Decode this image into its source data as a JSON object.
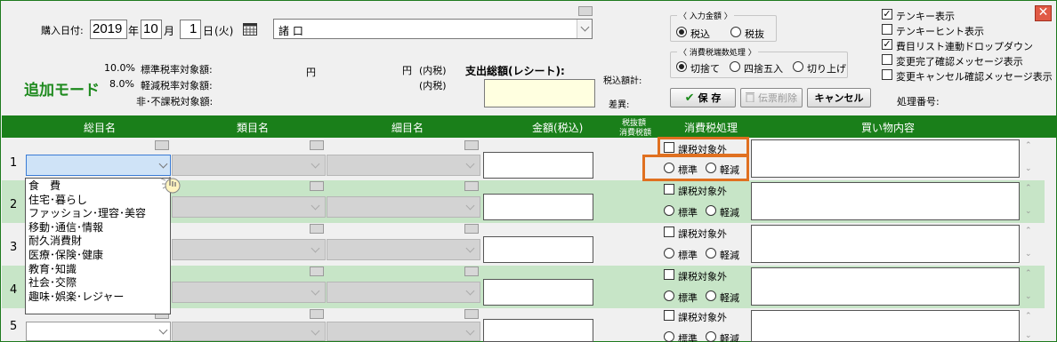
{
  "purchase_date": {
    "label": "購入日付:",
    "year": "2019",
    "year_unit": "年",
    "month": "10",
    "month_unit": "月",
    "day": "1",
    "day_unit": "日",
    "weekday": "(火)"
  },
  "store": {
    "value": "諸 口"
  },
  "mode": {
    "title": "追加モード"
  },
  "tax_summary": {
    "rate10": "10.0%",
    "rate10_label": "標準税率対象額:",
    "rate8": "8.0%",
    "rate8_label": "軽減税率対象額:",
    "nontax_label": "非･不課税対象額:",
    "yen": "円",
    "yen_incl": "円",
    "incl_tax1": "(内税)",
    "incl_tax2": "(内税)"
  },
  "total": {
    "label": "支出総額(レシート):",
    "incl_label": "税込額計:",
    "diff_label": "差異:"
  },
  "input_amount": {
    "title": "〈 入力金額 〉",
    "options": [
      "税込",
      "税抜"
    ],
    "selected": 0
  },
  "rounding": {
    "title": "〈 消費税端数処理 〉",
    "options": [
      "切捨て",
      "四捨五入",
      "切り上げ"
    ],
    "selected": 0
  },
  "buttons": {
    "save": "保 存",
    "delete": "伝票削除",
    "cancel": "キャンセル"
  },
  "process_no_label": "処理番号:",
  "options_list": [
    {
      "label": "テンキー表示",
      "checked": true
    },
    {
      "label": "テンキーヒント表示",
      "checked": false
    },
    {
      "label": "費目リスト連動ドロップダウン",
      "checked": true
    },
    {
      "label": "変更完了確認メッセージ表示",
      "checked": false
    },
    {
      "label": "変更キャンセル確認メッセージ表示",
      "checked": false
    }
  ],
  "columns": {
    "cat1": "総目名",
    "cat2": "類目名",
    "cat3": "細目名",
    "amount": "金額(税込)",
    "tax_excl1": "税抜額",
    "tax_excl2": "消費税額",
    "tax_proc": "消費税処理",
    "memo": "買い物内容"
  },
  "rows": [
    {
      "num": "1",
      "exempt": "課税対象外",
      "std": "標準",
      "reduced": "軽減"
    },
    {
      "num": "2",
      "exempt": "課税対象外",
      "std": "標準",
      "reduced": "軽減"
    },
    {
      "num": "3",
      "exempt": "課税対象外",
      "std": "標準",
      "reduced": "軽減"
    },
    {
      "num": "4",
      "exempt": "課税対象外",
      "std": "標準",
      "reduced": "軽減"
    },
    {
      "num": "5",
      "exempt": "課税対象外",
      "std": "標準",
      "reduced": "軽減"
    }
  ],
  "dropdown_items": [
    "食　費",
    "住宅･暮らし",
    "ファッション･理容･美容",
    "移動･通信･情報",
    "耐久消費財",
    "医療･保険･健康",
    "教育･知識",
    "社会･交際",
    "趣味･娯楽･レジャー"
  ],
  "colors": {
    "accent_green": "#1a7f1a",
    "mode_green": "#1e8a1e",
    "highlight_orange": "#e07020",
    "row_alt": "#c7e5c7",
    "total_box": "#ffffe0"
  },
  "icons": {
    "calendar": "calendar-icon",
    "save": "check-icon",
    "delete": "trash-icon",
    "close": "close-icon",
    "cursor": "hand-cursor-icon"
  }
}
